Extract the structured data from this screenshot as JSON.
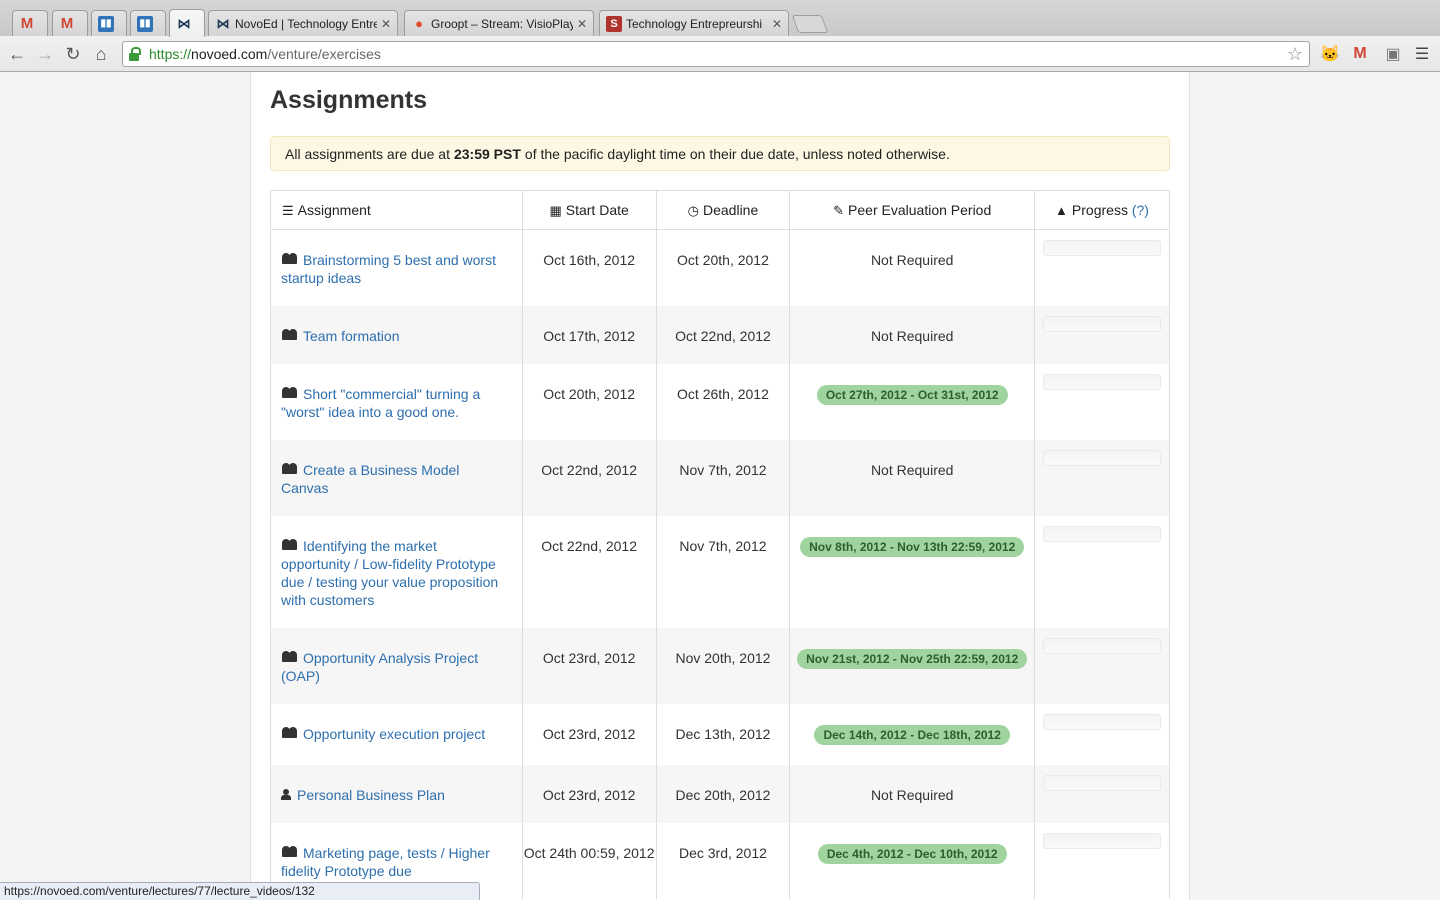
{
  "browser": {
    "tabs": [
      {
        "title": "",
        "favicon": "gmail-icon"
      },
      {
        "title": "",
        "favicon": "gmail-icon"
      },
      {
        "title": "",
        "favicon": "trello-icon"
      },
      {
        "title": "",
        "favicon": "trello-icon"
      },
      {
        "title": "",
        "favicon": "novoed-icon"
      },
      {
        "title": "NovoEd | Technology Entre",
        "favicon": "novoed-icon"
      },
      {
        "title": "Groopt – Stream: VisioPlay",
        "favicon": "groopt-icon"
      },
      {
        "title": "Technology Entrepreurshi",
        "favicon": "stanford-icon"
      }
    ],
    "url_scheme": "https://",
    "url_host": "novoed.com",
    "url_path": "/venture/exercises",
    "status_url": "https://novoed.com/venture/lectures/77/lecture_videos/132"
  },
  "page": {
    "title": "Assignments",
    "notice_prefix": "All assignments are due at",
    "notice_time": "23:59 PST",
    "notice_suffix": "of the pacific daylight time on their due date, unless noted otherwise."
  },
  "table": {
    "headers": {
      "assignment": "Assignment",
      "start_date": "Start Date",
      "deadline": "Deadline",
      "peer_eval": "Peer Evaluation Period",
      "progress": "Progress",
      "progress_help": "(?)"
    },
    "rows": [
      {
        "name": "Brainstorming 5 best and worst startup ideas",
        "type": "group",
        "start": "Oct 16th, 2012",
        "deadline": "Oct 20th, 2012",
        "peer": "Not Required",
        "peer_badge": false
      },
      {
        "name": "Team formation",
        "type": "group",
        "start": "Oct 17th, 2012",
        "deadline": "Oct 22nd, 2012",
        "peer": "Not Required",
        "peer_badge": false
      },
      {
        "name": "Short \"commercial\" turning a \"worst\" idea into a good one.",
        "type": "group",
        "start": "Oct 20th, 2012",
        "deadline": "Oct 26th, 2012",
        "peer": "Oct 27th, 2012 - Oct 31st, 2012",
        "peer_badge": true
      },
      {
        "name": "Create a Business Model Canvas",
        "type": "group",
        "start": "Oct 22nd, 2012",
        "deadline": "Nov 7th, 2012",
        "peer": "Not Required",
        "peer_badge": false
      },
      {
        "name": "Identifying the market opportunity / Low-fidelity Prototype due / testing your value proposition with customers",
        "type": "group",
        "start": "Oct 22nd, 2012",
        "deadline": "Nov 7th, 2012",
        "peer": "Nov 8th, 2012 - Nov 13th 22:59, 2012",
        "peer_badge": true
      },
      {
        "name": "Opportunity Analysis Project (OAP)",
        "type": "group",
        "start": "Oct 23rd, 2012",
        "deadline": "Nov 20th, 2012",
        "peer": "Nov 21st, 2012 - Nov 25th 22:59, 2012",
        "peer_badge": true
      },
      {
        "name": "Opportunity execution project",
        "type": "group",
        "start": "Oct 23rd, 2012",
        "deadline": "Dec 13th, 2012",
        "peer": "Dec 14th, 2012 - Dec 18th, 2012",
        "peer_badge": true
      },
      {
        "name": "Personal Business Plan",
        "type": "individual",
        "start": "Oct 23rd, 2012",
        "deadline": "Dec 20th, 2012",
        "peer": "Not Required",
        "peer_badge": false
      },
      {
        "name": "Marketing page, tests / Higher fidelity Prototype due",
        "type": "group",
        "start": "Oct 24th 00:59, 2012",
        "deadline": "Dec 3rd, 2012",
        "peer": "Dec 4th, 2012 - Dec 10th, 2012",
        "peer_badge": true
      }
    ]
  }
}
